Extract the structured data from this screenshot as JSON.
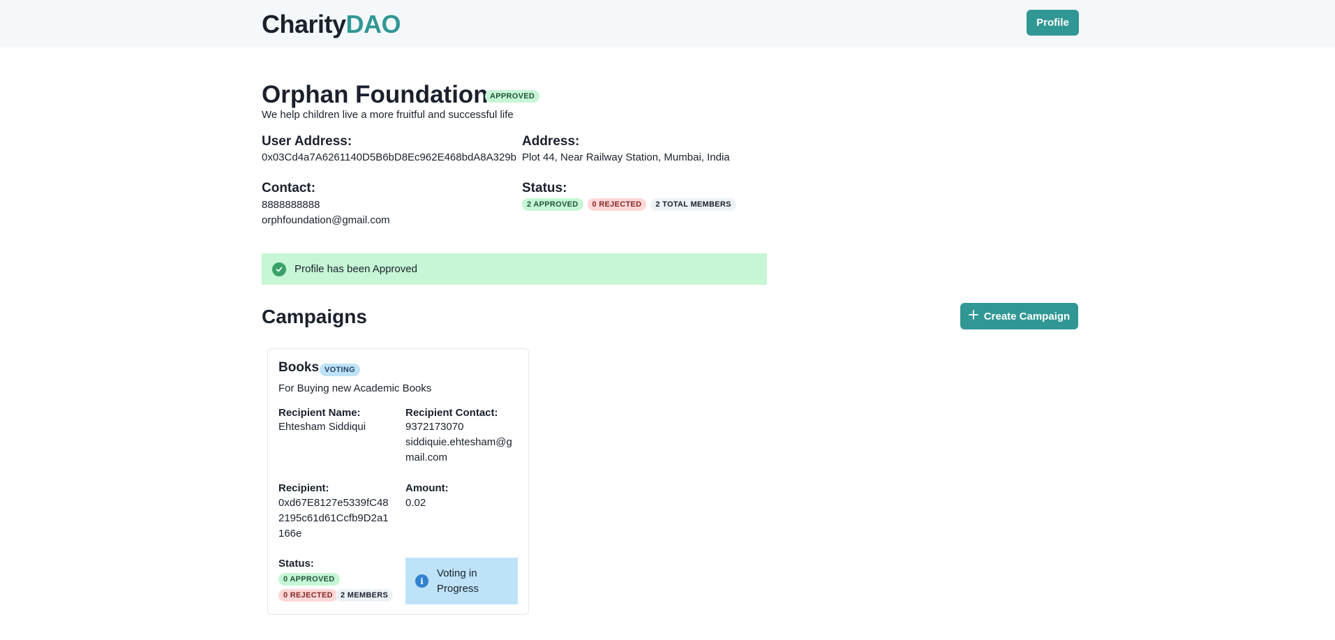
{
  "brand": {
    "part1": "Charity",
    "part2": "DAO"
  },
  "nav": {
    "profile_label": "Profile"
  },
  "org": {
    "name": "Orphan Foundation",
    "badge": "APPROVED",
    "tagline": "We help children live a more fruitful and successful life",
    "user_address_label": "User Address:",
    "user_address": "0x03Cd4a7A6261140D5B6bD8Ec962E468bdA8A329b",
    "address_label": "Address:",
    "address": "Plot 44, Near Railway Station, Mumbai, India",
    "contact_label": "Contact:",
    "phone": "8888888888",
    "email": "orphfoundation@gmail.com",
    "status_label": "Status:",
    "status_badges": {
      "approved": "2 APPROVED",
      "rejected": "0 REJECTED",
      "members": "2 TOTAL MEMBERS"
    }
  },
  "alert": {
    "text": "Profile has been Approved"
  },
  "campaigns": {
    "title": "Campaigns",
    "create_label": "Create Campaign",
    "items": [
      {
        "title": "Books",
        "badge": "VOTING",
        "description": "For Buying new Academic Books",
        "recipient_name_label": "Recipient Name:",
        "recipient_name": "Ehtesham Siddiqui",
        "recipient_contact_label": "Recipient Contact:",
        "recipient_phone": "9372173070",
        "recipient_email": "siddiquie.ehtesham@gmail.com",
        "recipient_label": "Recipient:",
        "recipient": "0xd67E8127e5339fC482195c61d61Ccfb9D2a1166e",
        "amount_label": "Amount:",
        "amount": "0.02",
        "status_label": "Status:",
        "status_badges": {
          "approved": "0 APPROVED",
          "rejected": "0 REJECTED",
          "members": "2 MEMBERS"
        },
        "info_text": "Voting in Progress"
      }
    ]
  },
  "colors": {
    "accent": "#319795",
    "success_bg": "#c6f6d5",
    "info_bg": "#bee3f8",
    "header_bg": "#f5f8fb"
  }
}
